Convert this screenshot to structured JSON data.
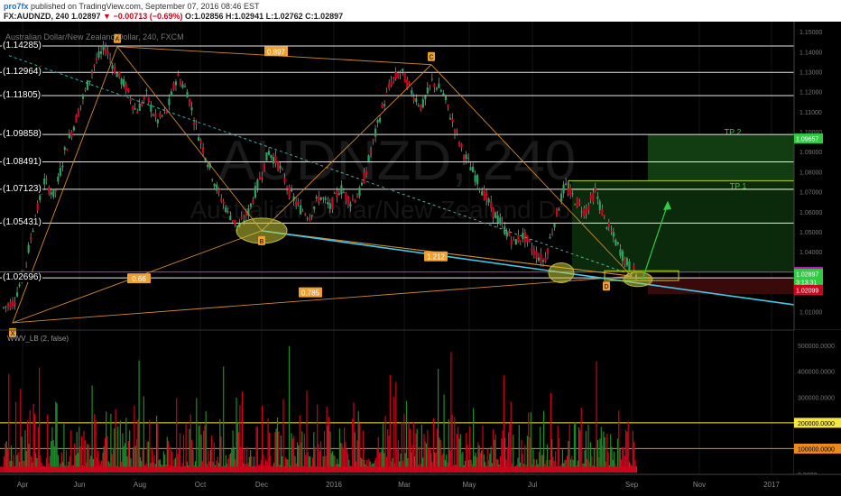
{
  "header": {
    "user": "pro7fx",
    "published": " published on TradingView.com, September 07, 2016 08:46 EST",
    "symbol_line_pre": "FX:AUDNZD, 240  1.02897 ",
    "change": "▼ −0.00713 (−0.69%)",
    "ohlc": " O:1.02856 H:1.02941 L:1.02762 C:1.02897"
  },
  "chart_data": {
    "type": "candlestick",
    "title": "Australian Dollar/New Zealand Dollar, 240, FXCM",
    "watermark_symbol": "AUDNZD, 240",
    "watermark_name": "Australian Dollar/New Zealand Dollar",
    "x_ticks": [
      "Apr",
      "Jun",
      "Aug",
      "Oct",
      "Dec",
      "2016",
      "Mar",
      "May",
      "Jul",
      "Sep",
      "Nov",
      "2017"
    ],
    "y_ticks": [
      "1.15000",
      "1.14000",
      "1.13000",
      "1.12000",
      "1.11000",
      "1.10000",
      "1.09000",
      "1.08000",
      "1.07000",
      "1.06000",
      "1.05000",
      "1.04000",
      "1.03000",
      "1.02000",
      "1.01000",
      "1.00000"
    ],
    "ylim": [
      0.995,
      1.155
    ],
    "fib_levels": [
      "1.14285",
      "1.12964",
      "1.11805",
      "1.09858",
      "1.08491",
      "1.07123",
      "1.05431",
      "1.02696"
    ],
    "price_tags": [
      {
        "value": "1.09657",
        "color": "#2ecc40"
      },
      {
        "value": "1.02992",
        "color": "#c815c8"
      },
      {
        "value": "1.02897",
        "color": "#2ecc40"
      },
      {
        "value": "3:13:31",
        "color": "#2ecc40"
      },
      {
        "value": "1.02885",
        "color": "#7f7f7f"
      },
      {
        "value": "1.02099",
        "color": "#d0021b"
      }
    ],
    "pattern_points": [
      "X",
      "A",
      "B",
      "C",
      "D"
    ],
    "ratios": [
      "0.897",
      "1.212",
      "0.66",
      "0.785"
    ],
    "targets": [
      "TP 2",
      "TP 1"
    ],
    "price_path": [
      1.012,
      1.015,
      1.03,
      1.055,
      1.075,
      1.068,
      1.09,
      1.105,
      1.12,
      1.135,
      1.142,
      1.13,
      1.122,
      1.11,
      1.118,
      1.105,
      1.11,
      1.128,
      1.12,
      1.1,
      1.085,
      1.07,
      1.06,
      1.052,
      1.06,
      1.075,
      1.09,
      1.083,
      1.07,
      1.062,
      1.058,
      1.068,
      1.062,
      1.072,
      1.065,
      1.07,
      1.09,
      1.11,
      1.125,
      1.13,
      1.12,
      1.112,
      1.125,
      1.12,
      1.105,
      1.09,
      1.08,
      1.07,
      1.06,
      1.052,
      1.045,
      1.048,
      1.04,
      1.035,
      1.055,
      1.073,
      1.066,
      1.06,
      1.07,
      1.055,
      1.045,
      1.035,
      1.029
    ],
    "indicator": {
      "name": "WWV_LB (2, false)",
      "y_ticks": [
        "500000.0000",
        "400000.0000",
        "300000.0000",
        "200000.0000",
        "100000.0000",
        "0.0000"
      ],
      "ylim": [
        0,
        560000
      ],
      "levels": [
        {
          "value": "200000.0000",
          "color": "#f5e642"
        },
        {
          "value": "100000.0000",
          "color": "#f0891a"
        }
      ]
    }
  }
}
